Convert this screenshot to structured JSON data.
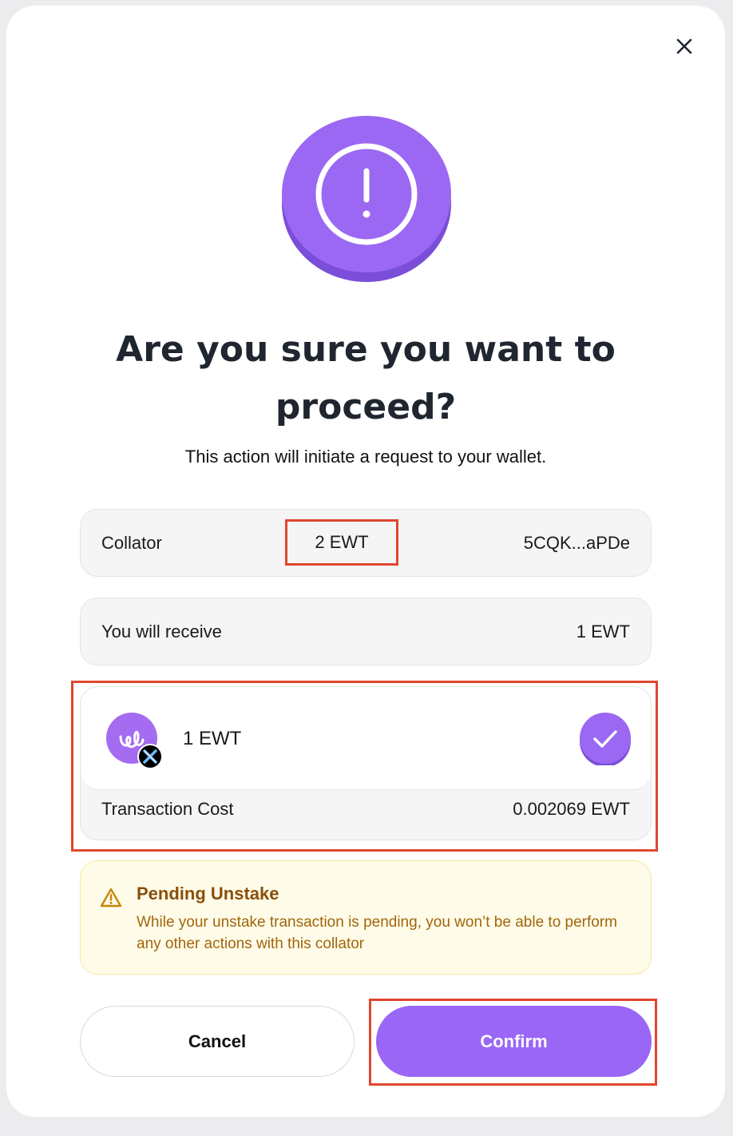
{
  "dialog": {
    "title": "Are you sure you want to proceed?",
    "subtitle": "This action will initiate a request to your wallet."
  },
  "collator_row": {
    "label": "Collator",
    "amount": "2 EWT",
    "address": "5CQK...aPDe"
  },
  "receive_row": {
    "label": "You will receive",
    "value": "1 EWT"
  },
  "token_card": {
    "amount": "1 EWT",
    "cost_label": "Transaction Cost",
    "cost_value": "0.002069 EWT"
  },
  "warning": {
    "title": "Pending Unstake",
    "text": "While your unstake transaction is pending, you won’t be able to perform any other actions with this collator"
  },
  "buttons": {
    "cancel_label": "Cancel",
    "confirm_label": "Confirm"
  },
  "icons": {
    "close": "close-icon",
    "alert": "exclamation-icon",
    "token": "energy-web-logo-icon",
    "check": "check-icon",
    "warning": "warning-triangle-icon"
  },
  "colors": {
    "accent": "#9966f5",
    "highlight": "#e0462f",
    "warning_bg": "#fefce8",
    "warning_text": "#a2650c"
  }
}
